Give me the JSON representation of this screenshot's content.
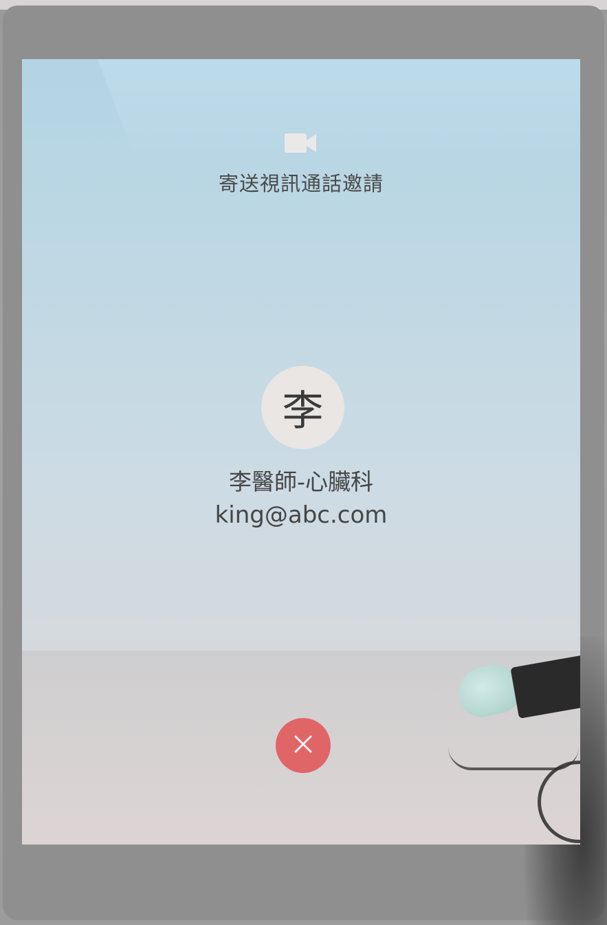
{
  "call": {
    "invite_label": "寄送視訊通話邀請",
    "camera_icon": "video-camera-icon"
  },
  "contact": {
    "avatar_initial": "李",
    "name": "李醫師-心臟科",
    "email": "king@abc.com"
  },
  "actions": {
    "cancel_icon": "close-icon",
    "cancel_color": "#e06567"
  },
  "colors": {
    "text": "#454545",
    "avatar_bg": "#e9e6e3"
  }
}
